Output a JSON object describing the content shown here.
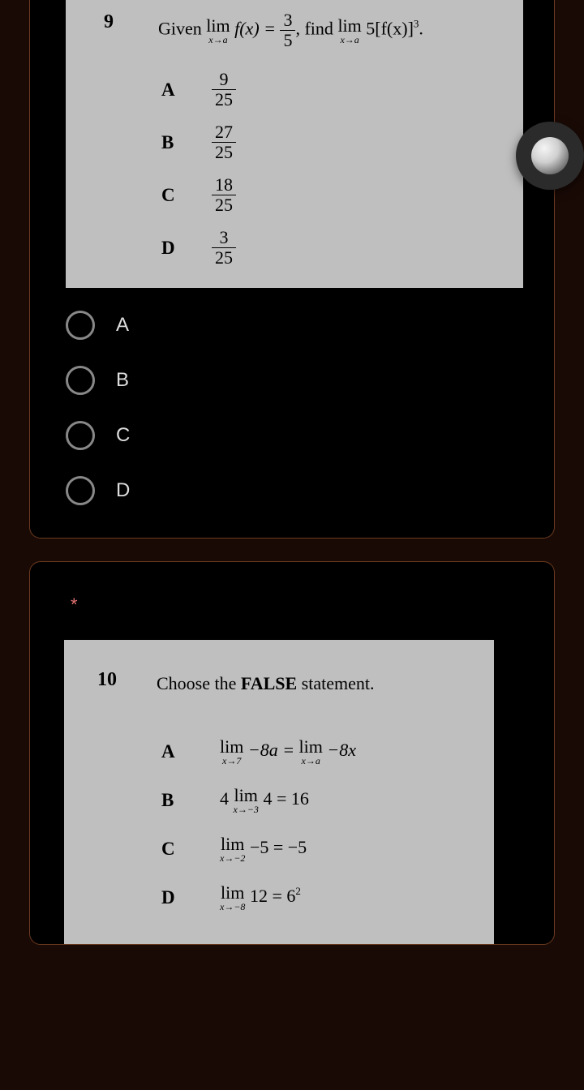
{
  "fab": {
    "name": "assistive-touch-icon"
  },
  "q9": {
    "number": "9",
    "prompt_prefix": "Given",
    "prompt_lim": "lim",
    "prompt_lim_sub": "x→a",
    "prompt_eq_lhs": "f(x) =",
    "prompt_frac_n": "3",
    "prompt_frac_d": "5",
    "prompt_mid": ", find",
    "prompt_rhs": "5[f(x)]",
    "prompt_pow": "3",
    "prompt_end": ".",
    "options": {
      "A": {
        "letter": "A",
        "n": "9",
        "d": "25"
      },
      "B": {
        "letter": "B",
        "n": "27",
        "d": "25"
      },
      "C": {
        "letter": "C",
        "n": "18",
        "d": "25"
      },
      "D": {
        "letter": "D",
        "n": "3",
        "d": "25"
      }
    },
    "choices": [
      "A",
      "B",
      "C",
      "D"
    ]
  },
  "q10": {
    "required_marker": "*",
    "number": "10",
    "prompt_prefix": "Choose the ",
    "prompt_strong": "FALSE",
    "prompt_suffix": " statement.",
    "options": {
      "A": {
        "letter": "A",
        "lim1": "lim",
        "sub1": "x→7",
        "mid1": " −8a = ",
        "lim2": "lim",
        "sub2": "x→a",
        "tail": " −8x"
      },
      "B": {
        "letter": "B",
        "pre": "4 ",
        "lim": "lim",
        "sub": "x→−3",
        "tail": " 4 = 16"
      },
      "C": {
        "letter": "C",
        "lim": "lim",
        "sub": "x→−2",
        "tail": " −5 = −5"
      },
      "D": {
        "letter": "D",
        "lim": "lim",
        "sub": "x→−8",
        "mid": " 12 = 6",
        "pow": "2"
      }
    }
  }
}
